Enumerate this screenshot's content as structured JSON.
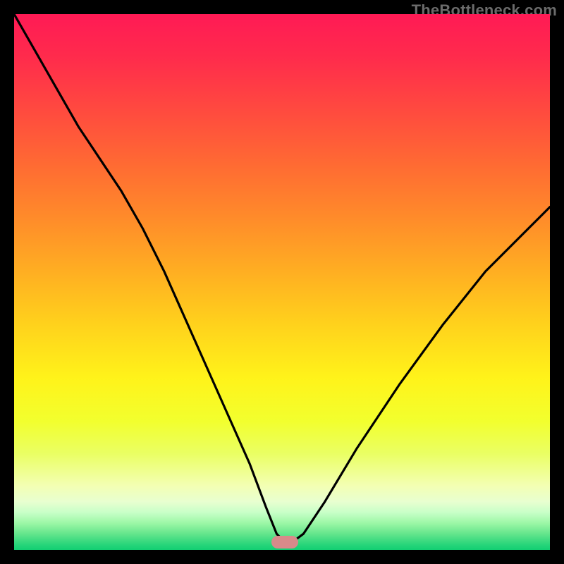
{
  "watermark": "TheBottleneck.com",
  "marker": {
    "x_frac": 0.505,
    "y_frac": 0.985
  },
  "chart_data": {
    "type": "line",
    "title": "",
    "xlabel": "",
    "ylabel": "",
    "xlim": [
      0,
      100
    ],
    "ylim": [
      0,
      100
    ],
    "annotations": [
      "TheBottleneck.com"
    ],
    "legend": [],
    "grid": false,
    "description": "V-shaped bottleneck curve over red→green vertical gradient; minimum (optimal point) marked by pill at bottom center.",
    "series": [
      {
        "name": "bottleneck-curve",
        "x": [
          0,
          4,
          8,
          12,
          16,
          20,
          24,
          28,
          32,
          36,
          40,
          44,
          47,
          49,
          50.5,
          52,
          54,
          58,
          64,
          72,
          80,
          88,
          96,
          100
        ],
        "y": [
          100,
          93,
          86,
          79,
          73,
          67,
          60,
          52,
          43,
          34,
          25,
          16,
          8,
          3,
          1.5,
          1.5,
          3,
          9,
          19,
          31,
          42,
          52,
          60,
          64
        ]
      }
    ],
    "background_gradient_stops": [
      {
        "pos": 0.0,
        "color": "#ff1a55"
      },
      {
        "pos": 0.18,
        "color": "#ff4a3f"
      },
      {
        "pos": 0.38,
        "color": "#ff8b2a"
      },
      {
        "pos": 0.58,
        "color": "#ffd21c"
      },
      {
        "pos": 0.76,
        "color": "#f2ff2e"
      },
      {
        "pos": 0.91,
        "color": "#e8ffd0"
      },
      {
        "pos": 1.0,
        "color": "#12cf73"
      }
    ]
  }
}
